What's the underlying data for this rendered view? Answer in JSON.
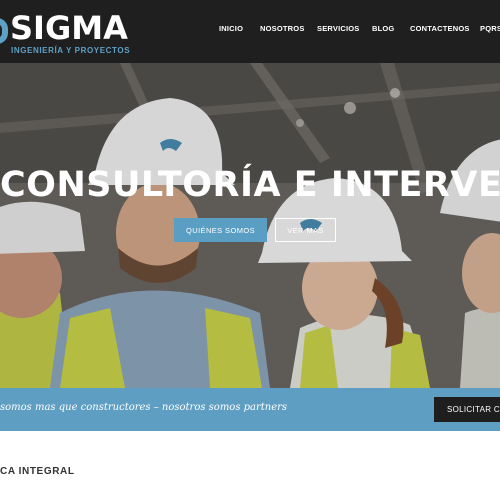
{
  "brand": {
    "name": "SIGMA",
    "tagline": "INGENIERÍA Y PROYECTOS",
    "accent": "#5e9ec3",
    "dark": "#1f1f1f"
  },
  "nav": {
    "items": [
      "INICIO",
      "NOSOTROS",
      "SERVICIOS",
      "BLOG",
      "CONTACTENOS",
      "PQRS"
    ]
  },
  "hero": {
    "title": "CONSULTORÍA E INTERVENTORÍA",
    "primary_button": "QUIÉNES SOMOS",
    "secondary_button": "VER MAS"
  },
  "banner": {
    "text": "somos mas que constructores – nosotros somos partners",
    "button": "SOLICITAR CO"
  },
  "section": {
    "title": "CA INTEGRAL"
  }
}
